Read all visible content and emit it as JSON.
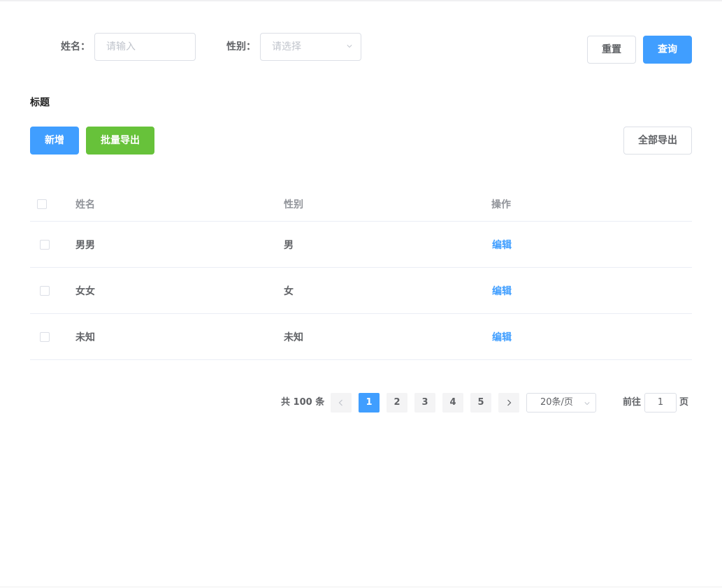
{
  "search": {
    "name_label": "姓名：",
    "name_placeholder": "请输入",
    "gender_label": "性别：",
    "gender_placeholder": "请选择",
    "reset_label": "重置",
    "query_label": "查询"
  },
  "section": {
    "title": "标题",
    "add_label": "新增",
    "batch_export_label": "批量导出",
    "export_all_label": "全部导出"
  },
  "table": {
    "columns": [
      "姓名",
      "性别",
      "操作"
    ],
    "rows": [
      {
        "name": "男男",
        "gender": "男",
        "action": "编辑"
      },
      {
        "name": "女女",
        "gender": "女",
        "action": "编辑"
      },
      {
        "name": "未知",
        "gender": "未知",
        "action": "编辑"
      }
    ]
  },
  "pagination": {
    "total_text": "共 100 条",
    "pages": [
      "1",
      "2",
      "3",
      "4",
      "5"
    ],
    "current_page": "1",
    "page_size": "20条/页",
    "goto_label": "前往",
    "goto_value": "1",
    "goto_suffix": "页"
  },
  "colors": {
    "primary": "#409eff",
    "success": "#67c23a",
    "border": "#dcdfe6",
    "text": "#606266",
    "muted": "#909399",
    "placeholder": "#c0c4cc"
  },
  "icons": [
    "chevron-down-icon",
    "chevron-left-icon",
    "chevron-right-icon",
    "checkbox-icon"
  ]
}
